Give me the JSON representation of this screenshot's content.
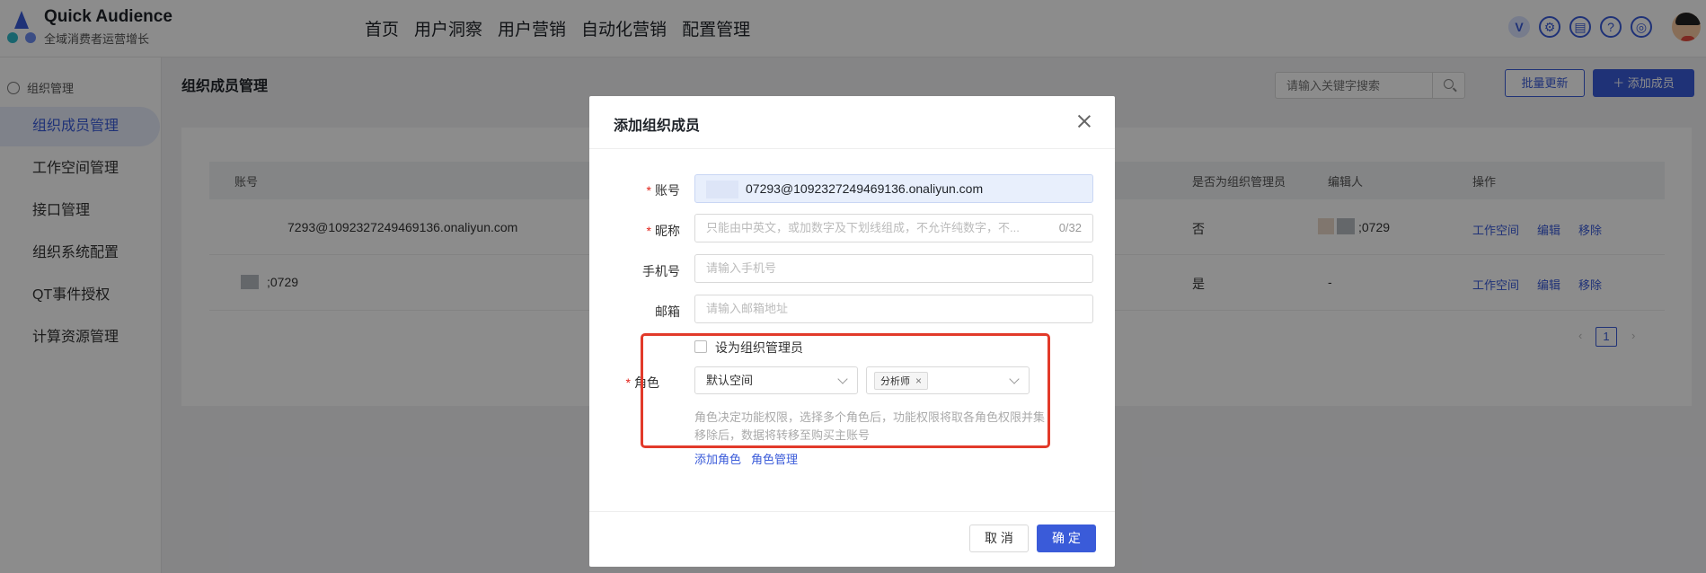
{
  "brand": {
    "name": "Quick Audience",
    "subtitle": "全域消费者运营增长"
  },
  "nav": {
    "items": [
      "首页",
      "用户洞察",
      "用户营销",
      "自动化营销",
      "配置管理"
    ]
  },
  "header_icons": {
    "v_badge": "V"
  },
  "sidebar": {
    "group": "组织管理",
    "items": [
      "组织成员管理",
      "工作空间管理",
      "接口管理",
      "组织系统配置",
      "QT事件授权",
      "计算资源管理"
    ]
  },
  "page": {
    "title": "组织成员管理",
    "search_placeholder": "请输入关键字搜索",
    "batch_update": "批量更新",
    "add_member": "＋ 添加成员"
  },
  "table": {
    "headers": {
      "account": "账号",
      "is_admin": "是否为组织管理员",
      "editor": "编辑人",
      "actions": "操作"
    },
    "rows": [
      {
        "account": "7293@1092327249469136.onaliyun.com",
        "is_admin": "否",
        "editor": ";0729",
        "actions": [
          "工作空间",
          "编辑",
          "移除"
        ]
      },
      {
        "account": ";0729",
        "is_admin": "是",
        "editor": "-",
        "actions": [
          "工作空间",
          "编辑",
          "移除"
        ]
      }
    ],
    "pager": {
      "page": "1",
      "prev": "‹",
      "next": "›"
    }
  },
  "modal": {
    "title": "添加组织成员",
    "required_mark": "*",
    "fields": {
      "account": {
        "label": "账号",
        "value": "07293@1092327249469136.onaliyun.com"
      },
      "nickname": {
        "label": "昵称",
        "placeholder": "只能由中英文，或加数字及下划线组成，不允许纯数字，不...",
        "count": "0/32"
      },
      "phone": {
        "label": "手机号",
        "placeholder": "请输入手机号"
      },
      "email": {
        "label": "邮箱",
        "placeholder": "请输入邮箱地址"
      }
    },
    "admin_checkbox": "设为组织管理员",
    "role": {
      "label": "角色",
      "workspace": "默认空间",
      "tag": "分析师",
      "hint_line1": "角色决定功能权限，选择多个角色后，功能权限将取各角色权限并集",
      "hint_line2": "移除后，数据将转移至购买主账号",
      "add_role": "添加角色",
      "manage_role": "角色管理"
    },
    "buttons": {
      "cancel": "取 消",
      "ok": "确 定"
    }
  },
  "colors": {
    "primary": "#3a5bd9",
    "required": "#e2231a",
    "highlight_border": "#e23a2a"
  }
}
